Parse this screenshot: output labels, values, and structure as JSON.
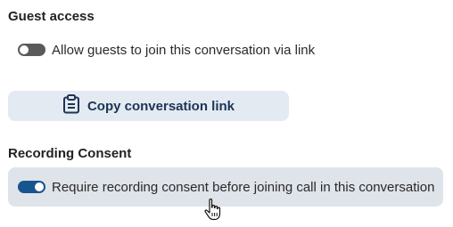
{
  "guest_access": {
    "heading": "Guest access",
    "toggle_label": "Allow guests to join this conversation via link",
    "toggle_on": false
  },
  "copy_link": {
    "label": "Copy conversation link",
    "icon": "clipboard-icon"
  },
  "recording_consent": {
    "heading": "Recording Consent",
    "toggle_label": "Require recording consent before joining call in this conversation",
    "toggle_on": true
  },
  "colors": {
    "toggle_on": "#17558f",
    "toggle_off": "#5a5a5a",
    "button_background": "#e3eaf2",
    "highlight_row": "#dfe3ea"
  },
  "cursor": "hand-pointer-icon"
}
